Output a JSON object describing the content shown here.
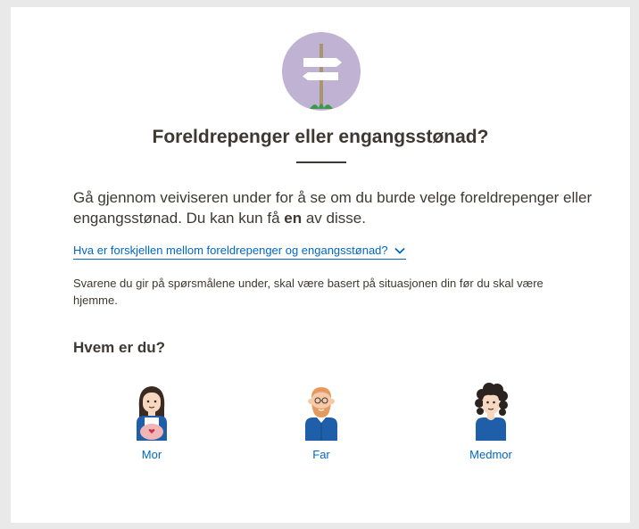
{
  "page": {
    "title": "Foreldrepenger eller engangsstønad?",
    "intro_part1": "Gå gjennom veiviseren under for å se om du burde velge foreldrepenger eller engangsstønad. Du kan kun få ",
    "intro_bold": "en",
    "intro_part2": " av disse.",
    "accordion_label": "Hva er forskjellen mellom foreldrepenger og engangsstønad?",
    "accordion_icon": "chevron-down-icon",
    "note": "Svarene du gir på spørsmålene under, skal være basert på situasjonen din før du skal være hjemme.",
    "question": "Hvem er du?",
    "hero_icon": "signpost-icon"
  },
  "options": [
    {
      "label": "Mor",
      "icon": "mother-icon"
    },
    {
      "label": "Far",
      "icon": "father-icon"
    },
    {
      "label": "Medmor",
      "icon": "co-mother-icon"
    }
  ],
  "colors": {
    "link": "#0067c5",
    "text": "#3e3832",
    "hero_circle": "#c0b2d2",
    "shirt": "#1f5ea8",
    "background": "#e9e9e9"
  }
}
